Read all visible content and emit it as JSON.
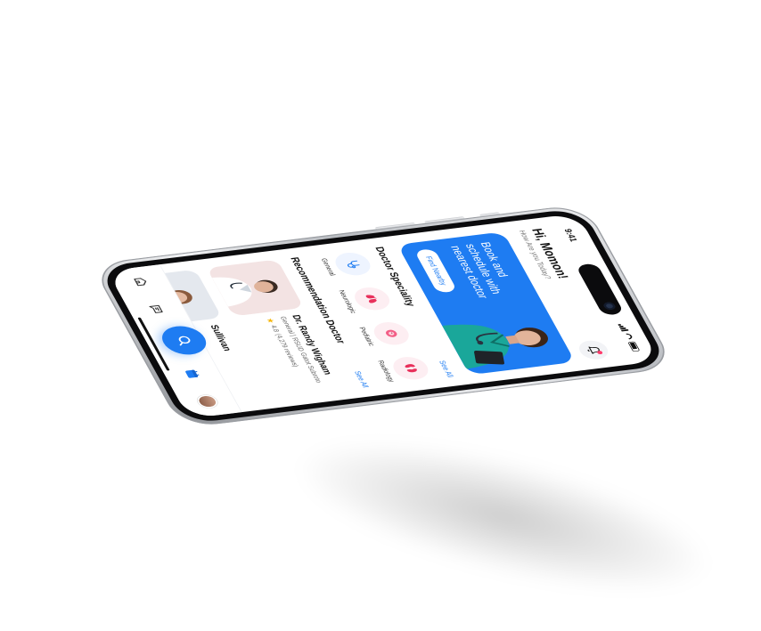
{
  "status_bar": {
    "time": "9:41"
  },
  "header": {
    "greeting": "Hi, Momon!",
    "subtitle": "How Are you Today?"
  },
  "banner": {
    "headline": "Book and schedule with nearest doctor",
    "cta_label": "Find Nearby"
  },
  "speciality": {
    "title": "Doctor Speciality",
    "see_all": "See All",
    "items": [
      {
        "label": "General",
        "icon": "stethoscope-icon"
      },
      {
        "label": "Neurologic",
        "icon": "lungs-icon"
      },
      {
        "label": "Pediatric",
        "icon": "baby-icon"
      },
      {
        "label": "Radiology",
        "icon": "kidney-icon"
      }
    ]
  },
  "recommendation": {
    "title": "Recommendation Doctor",
    "see_all": "See All",
    "doctors": [
      {
        "name": "Dr. Randy Wigham",
        "specialty": "General",
        "hospital": "RSUD Gatot Subroto",
        "rating": "4.8",
        "reviews": "(4,279 reviews)"
      },
      {
        "name": "Sullivan"
      }
    ]
  },
  "tabbar": {
    "items": [
      "home-icon",
      "chat-icon",
      "search-icon",
      "calendar-icon",
      "profile-avatar"
    ]
  },
  "colors": {
    "primary": "#1E7CF2",
    "accent_pink": "#FF3B6B",
    "star": "#F6B400"
  }
}
